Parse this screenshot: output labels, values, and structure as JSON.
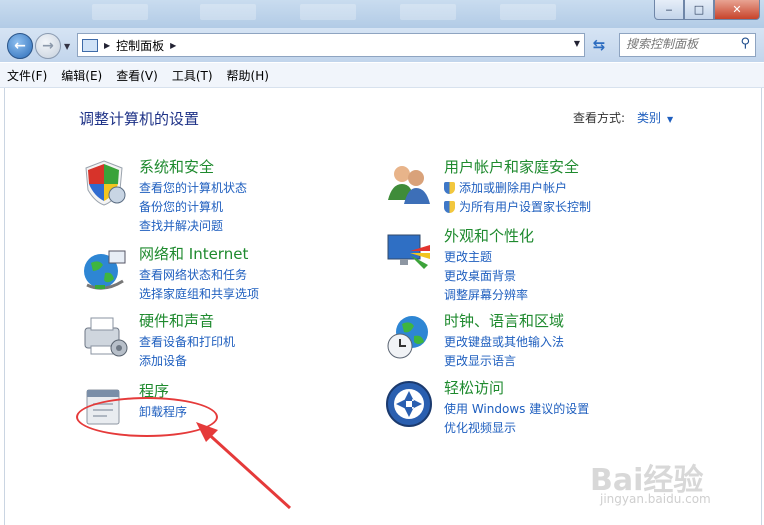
{
  "window": {
    "controls": {
      "minimize": "‒",
      "maximize": "□",
      "close": "✕"
    }
  },
  "navigation": {
    "address": {
      "segment": "控制面板"
    },
    "search": {
      "placeholder": "搜索控制面板"
    }
  },
  "menu": [
    "文件(F)",
    "编辑(E)",
    "查看(V)",
    "工具(T)",
    "帮助(H)"
  ],
  "page": {
    "title": "调整计算机的设置",
    "view_by_label": "查看方式:",
    "view_by_value": "类别"
  },
  "categories": [
    {
      "title": "系统和安全",
      "icon": "shield-icon",
      "links": [
        "查看您的计算机状态",
        "备份您的计算机",
        "查找并解决问题"
      ]
    },
    {
      "title": "网络和 Internet",
      "icon": "network-globe-icon",
      "links": [
        "查看网络状态和任务",
        "选择家庭组和共享选项"
      ]
    },
    {
      "title": "硬件和声音",
      "icon": "printer-icon",
      "links": [
        "查看设备和打印机",
        "添加设备"
      ]
    },
    {
      "title": "程序",
      "icon": "programs-icon",
      "links": [
        "卸载程序"
      ]
    },
    {
      "title": "用户帐户和家庭安全",
      "icon": "users-icon",
      "links": [
        "添加或删除用户帐户",
        "为所有用户设置家长控制"
      ]
    },
    {
      "title": "外观和个性化",
      "icon": "monitor-paint-icon",
      "links": [
        "更改主题",
        "更改桌面背景",
        "调整屏幕分辨率"
      ]
    },
    {
      "title": "时钟、语言和区域",
      "icon": "clock-globe-icon",
      "links": [
        "更改键盘或其他输入法",
        "更改显示语言"
      ]
    },
    {
      "title": "轻松访问",
      "icon": "accessibility-icon",
      "links": [
        "使用 Windows 建议的设置",
        "优化视频显示"
      ]
    }
  ],
  "watermark": {
    "brand": "Bai经验",
    "url": "jingyan.baidu.com"
  },
  "colors": {
    "category_title": "#1e8a2e",
    "link": "#1f5fbf",
    "annotation": "#e53a3a"
  }
}
